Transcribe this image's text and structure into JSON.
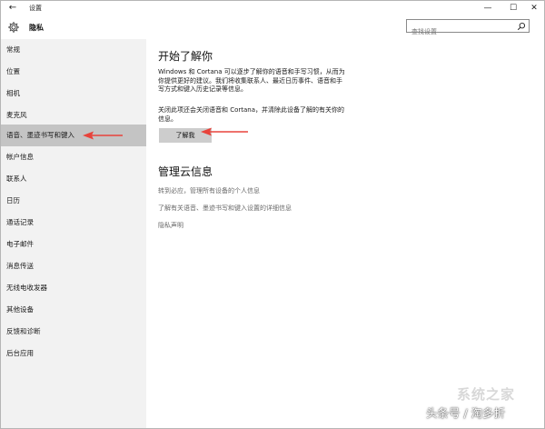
{
  "window": {
    "back_glyph": "←",
    "title": "设置",
    "minimize_glyph": "—",
    "maximize_glyph": "☐",
    "close_glyph": "✕"
  },
  "header": {
    "icon": "gear-icon",
    "title": "隐私",
    "search_placeholder": "查找设置",
    "search_icon": "search-icon"
  },
  "sidebar": {
    "items": [
      {
        "label": "常规"
      },
      {
        "label": "位置"
      },
      {
        "label": "相机"
      },
      {
        "label": "麦克风"
      },
      {
        "label": "语音、墨迹书写和键入",
        "active": true
      },
      {
        "label": "帐户信息"
      },
      {
        "label": "联系人"
      },
      {
        "label": "日历"
      },
      {
        "label": "通话记录"
      },
      {
        "label": "电子邮件"
      },
      {
        "label": "消息传送"
      },
      {
        "label": "无线电收发器"
      },
      {
        "label": "其他设备"
      },
      {
        "label": "反馈和诊断"
      },
      {
        "label": "后台应用"
      }
    ]
  },
  "main": {
    "section1_title": "开始了解你",
    "para1_line1": "Windows 和 Cortana 可以逐步了解你的语音和手写习惯，从而为",
    "para1_line2": "你提供更好的建议。我们将收集联系人、最近日历事件、语音和手",
    "para1_line3": "写方式和键入历史记录等信息。",
    "para2_line1": "关闭此项还会关闭语音和 Cortana，并清除此设备了解的有关你的",
    "para2_line2": "信息。",
    "button_label": "了解我",
    "section2_title": "管理云信息",
    "link1": "转到必应，管理所有设备的个人信息",
    "link2": "了解有关语音、墨迹书写和键入设置的详细信息",
    "link3": "隐私声明"
  },
  "annotation": {
    "arrow_color": "#e8433b"
  },
  "watermark": {
    "logo_text": "系统之家",
    "credit": "头条号 / 淘多折"
  }
}
